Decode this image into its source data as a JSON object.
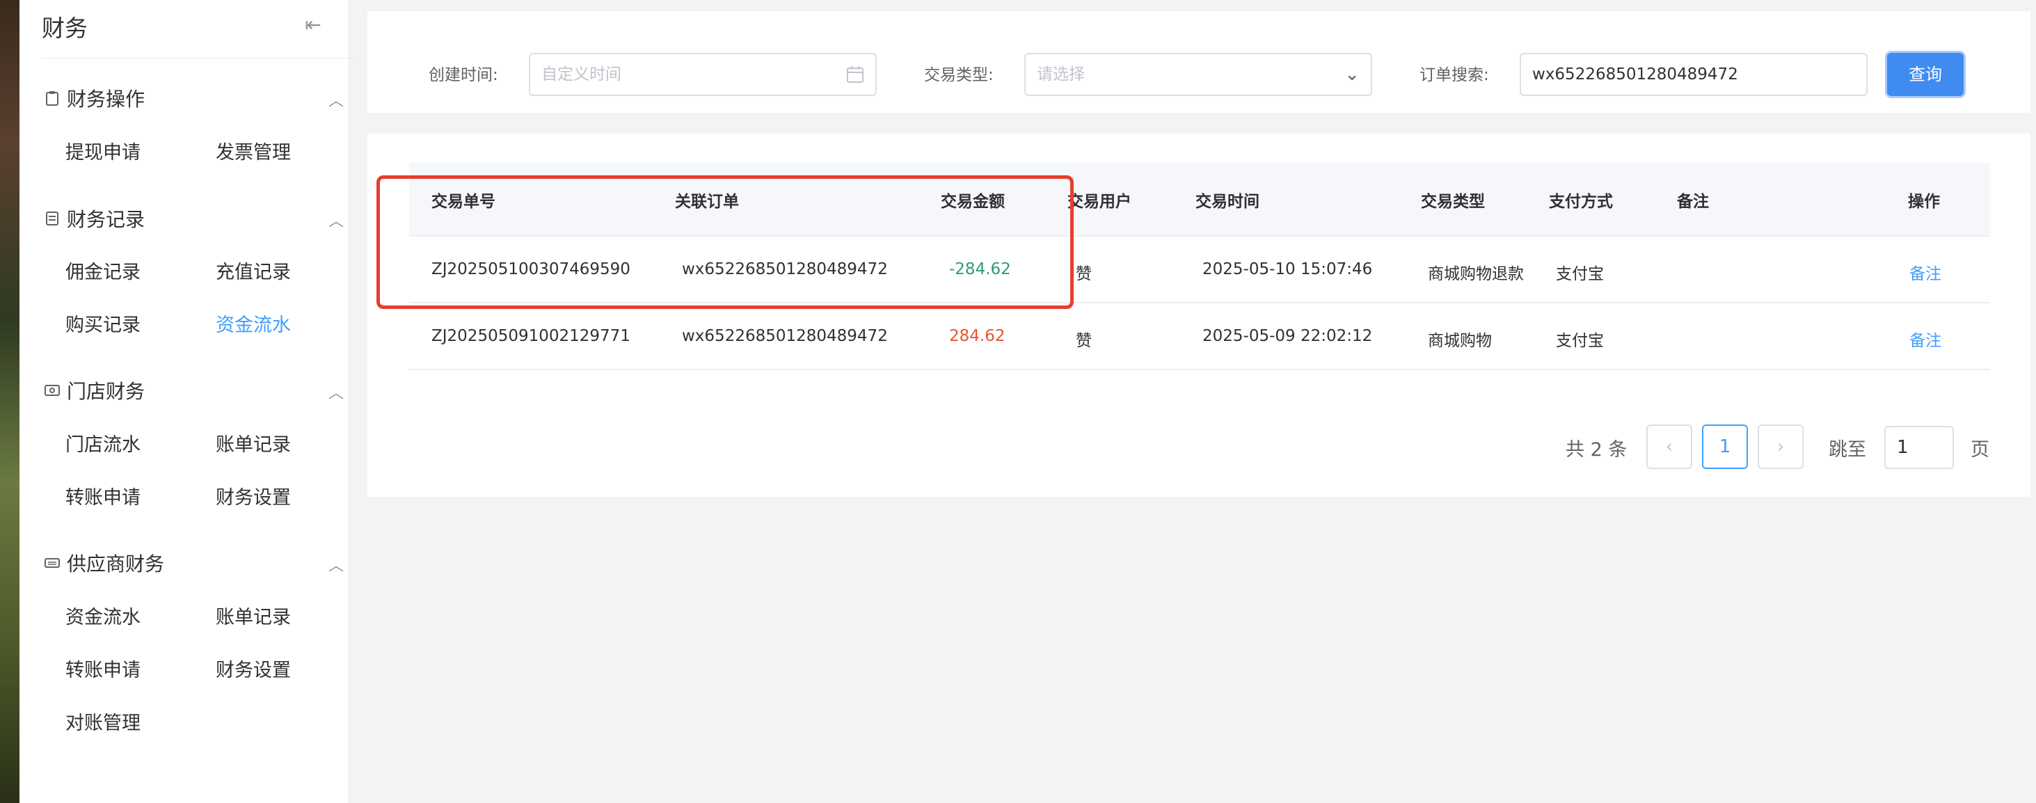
{
  "sidebar": {
    "title": "财务",
    "collapse_icon": "collapse-left-icon",
    "groups": [
      {
        "label": "财务操作",
        "icon": "clipboard-icon",
        "items": [
          "提现申请",
          "发票管理"
        ]
      },
      {
        "label": "财务记录",
        "icon": "document-icon",
        "items": [
          "佣金记录",
          "充值记录",
          "购买记录",
          "资金流水"
        ]
      },
      {
        "label": "门店财务",
        "icon": "cash-icon",
        "items": [
          "门店流水",
          "账单记录",
          "转账申请",
          "财务设置"
        ]
      },
      {
        "label": "供应商财务",
        "icon": "keyboard-icon",
        "items": [
          "资金流水",
          "账单记录",
          "转账申请",
          "财务设置",
          "对账管理"
        ]
      }
    ],
    "active_item": "资金流水"
  },
  "filters": {
    "created_time_label": "创建时间:",
    "created_time_placeholder": "自定义时间",
    "trade_type_label": "交易类型:",
    "trade_type_placeholder": "请选择",
    "order_search_label": "订单搜索:",
    "order_search_value": "wx652268501280489472",
    "query_button": "查询"
  },
  "table": {
    "columns": [
      "交易单号",
      "关联订单",
      "交易金额",
      "交易用户",
      "交易时间",
      "交易类型",
      "支付方式",
      "备注",
      "操作"
    ],
    "rows": [
      {
        "trade_no": "ZJ202505100307469590",
        "order": "wx652268501280489472",
        "amount": "-284.62",
        "user": "赞",
        "time": "2025-05-10 15:07:46",
        "type": "商城购物退款",
        "pay": "支付宝",
        "remark": "",
        "action": "备注"
      },
      {
        "trade_no": "ZJ202505091002129771",
        "order": "wx652268501280489472",
        "amount": "284.62",
        "user": "赞",
        "time": "2025-05-09 22:02:12",
        "type": "商城购物",
        "pay": "支付宝",
        "remark": "",
        "action": "备注"
      }
    ]
  },
  "pagination": {
    "total_text": "共 2 条",
    "current_page": "1",
    "jump_label": "跳至",
    "jump_value": "1",
    "page_label": "页"
  },
  "colors": {
    "accent": "#409eff",
    "negative_amount": "#2e9d6e",
    "positive_amount": "#e8562e",
    "highlight": "#e63e2e"
  }
}
